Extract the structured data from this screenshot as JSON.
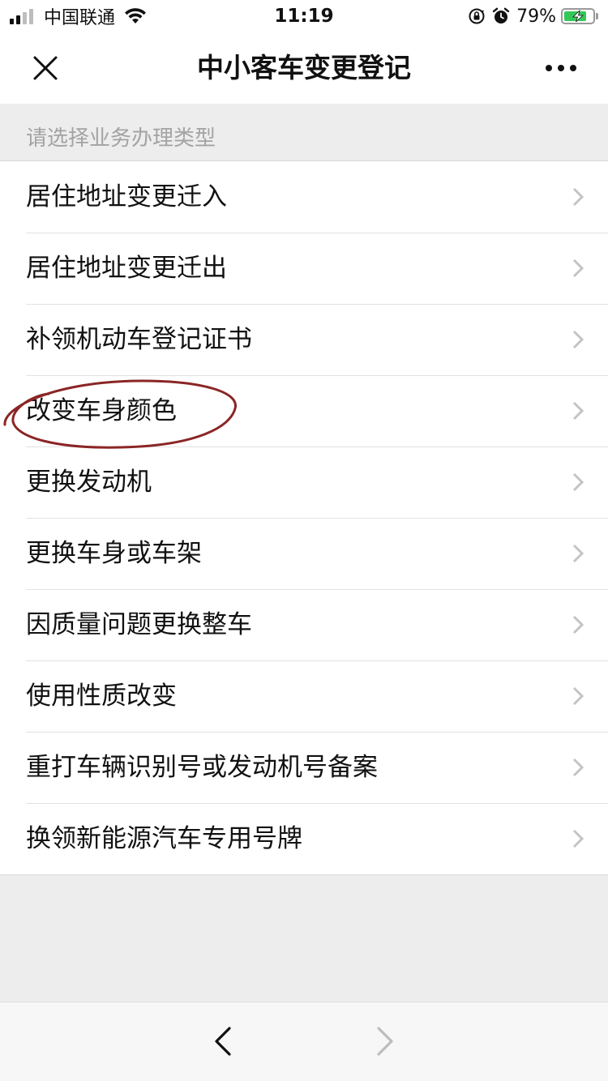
{
  "status_bar": {
    "carrier": "中国联通",
    "time": "11:19",
    "battery_percent_label": "79%",
    "battery_level": 0.79,
    "icons": [
      "signal-icon",
      "wifi-icon",
      "orientation-lock-icon",
      "alarm-icon",
      "battery-icon"
    ]
  },
  "nav": {
    "title": "中小客车变更登记",
    "close_icon": "close-icon",
    "more_icon": "more-icon"
  },
  "section": {
    "header": "请选择业务办理类型"
  },
  "items": [
    {
      "label": "居住地址变更迁入"
    },
    {
      "label": "居住地址变更迁出"
    },
    {
      "label": "补领机动车登记证书"
    },
    {
      "label": "改变车身颜色"
    },
    {
      "label": "更换发动机"
    },
    {
      "label": "更换车身或车架"
    },
    {
      "label": "因质量问题更换整车"
    },
    {
      "label": "使用性质改变"
    },
    {
      "label": "重打车辆识别号或发动机号备案"
    },
    {
      "label": "换领新能源汽车专用号牌"
    }
  ],
  "colors": {
    "annotation_circle": "#8b2525",
    "battery_fill": "#34c759"
  },
  "bottom_bar": {
    "back_icon": "back-arrow-icon",
    "forward_icon": "forward-arrow-icon"
  }
}
